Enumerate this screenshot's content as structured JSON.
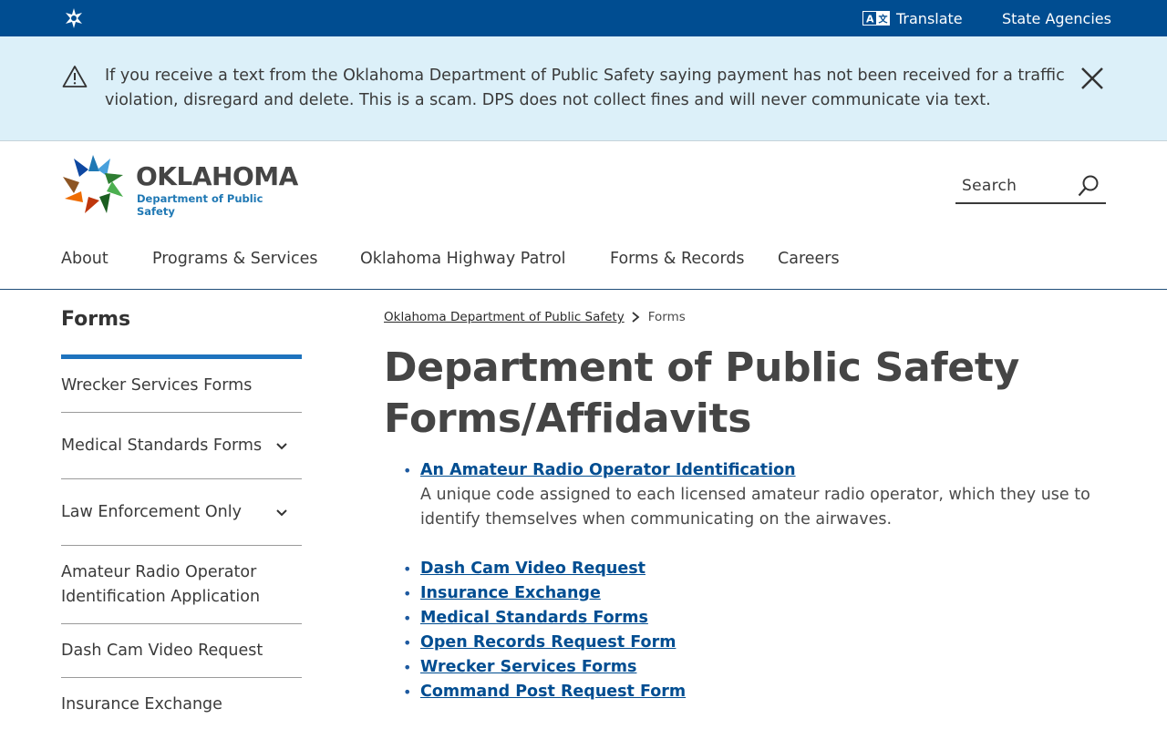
{
  "topbar": {
    "logo_icon": "oklahoma-star-icon",
    "translate_label": "Translate",
    "translate_icon": "translate-icon",
    "agencies_label": "State Agencies"
  },
  "alert": {
    "icon": "warning-icon",
    "message": "If you receive a text from the Oklahoma Department of Public Safety saying payment has not been received for a traffic violation, disregard and delete. This is a scam. DPS does not collect fines and will never communicate via text.",
    "close_icon": "close-icon"
  },
  "header": {
    "logo_title": "OKLAHOMA",
    "logo_subtitle": "Department of Public Safety",
    "search_placeholder": "Search"
  },
  "nav": {
    "items": [
      "About",
      "Programs & Services",
      "Oklahoma Highway Patrol",
      "Forms & Records",
      "Careers"
    ]
  },
  "sidebar": {
    "title": "Forms",
    "items": [
      {
        "label": "Wrecker Services Forms",
        "expandable": false
      },
      {
        "label": "Medical Standards Forms",
        "expandable": true
      },
      {
        "label": "Law Enforcement Only",
        "expandable": true
      },
      {
        "label": "Amateur Radio Operator Identification Application",
        "expandable": false
      },
      {
        "label": "Dash Cam Video Request",
        "expandable": false
      },
      {
        "label": "Insurance Exchange",
        "expandable": false
      }
    ]
  },
  "breadcrumb": {
    "home": "Oklahoma Department of Public Safety",
    "current": "Forms"
  },
  "page": {
    "title": "Department of Public Safety Forms/Affidavits",
    "links": [
      {
        "label": "An Amateur Radio Operator Identification",
        "description": "A unique code assigned to each licensed amateur radio operator, which they use to identify themselves when communicating on the airwaves."
      },
      {
        "label": "Dash Cam Video Request"
      },
      {
        "label": "Insurance Exchange"
      },
      {
        "label": "Medical Standards Forms"
      },
      {
        "label": "Open Records Request Form"
      },
      {
        "label": "Wrecker Services Forms"
      },
      {
        "label": "Command Post Request Form"
      }
    ]
  },
  "colors": {
    "topbar": "#004d91",
    "alert_bg": "#dcf0f9",
    "link": "#004d91",
    "accent": "#1e73be"
  }
}
